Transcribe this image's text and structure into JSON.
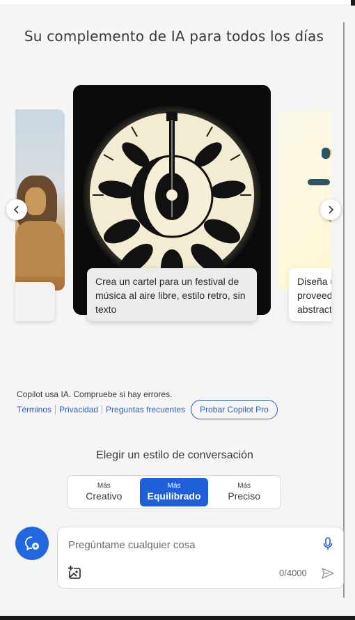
{
  "headline": "Su complemento de IA para todos los días",
  "carousel": {
    "prev_icon": "chevron-left-icon",
    "next_icon": "chevron-right-icon",
    "cards": [
      {
        "image": "lion-savanna-image",
        "caption": ""
      },
      {
        "image": "guitar-moon-poster-image",
        "caption": "Crea un cartel para un festival de música al aire libre, estilo retro, sin texto"
      },
      {
        "image": "abstract-logo-image",
        "caption_lines": [
          "Diseña u",
          "proveed",
          "abstract"
        ]
      }
    ]
  },
  "notice": {
    "text": "Copilot usa IA. Compruebe si hay errores.",
    "links": [
      "Términos",
      "Privacidad",
      "Preguntas frecuentes"
    ],
    "pro_button": "Probar Copilot Pro"
  },
  "style_picker": {
    "title": "Elegir un estilo de conversación",
    "options": [
      {
        "small": "Más",
        "big": "Creativo",
        "active": false
      },
      {
        "small": "Más",
        "big": "Equilibrado",
        "active": true
      },
      {
        "small": "Más",
        "big": "Preciso",
        "active": false
      }
    ]
  },
  "composer": {
    "placeholder": "Pregúntame cualquier cosa",
    "counter": "0/4000",
    "new_topic_icon": "new-topic-chat-icon",
    "mic_icon": "microphone-icon",
    "image_icon": "add-image-icon",
    "send_icon": "send-icon"
  },
  "colors": {
    "accent": "#1f5fd9",
    "link": "#2f5fb3",
    "background": "#f5f5f5"
  }
}
